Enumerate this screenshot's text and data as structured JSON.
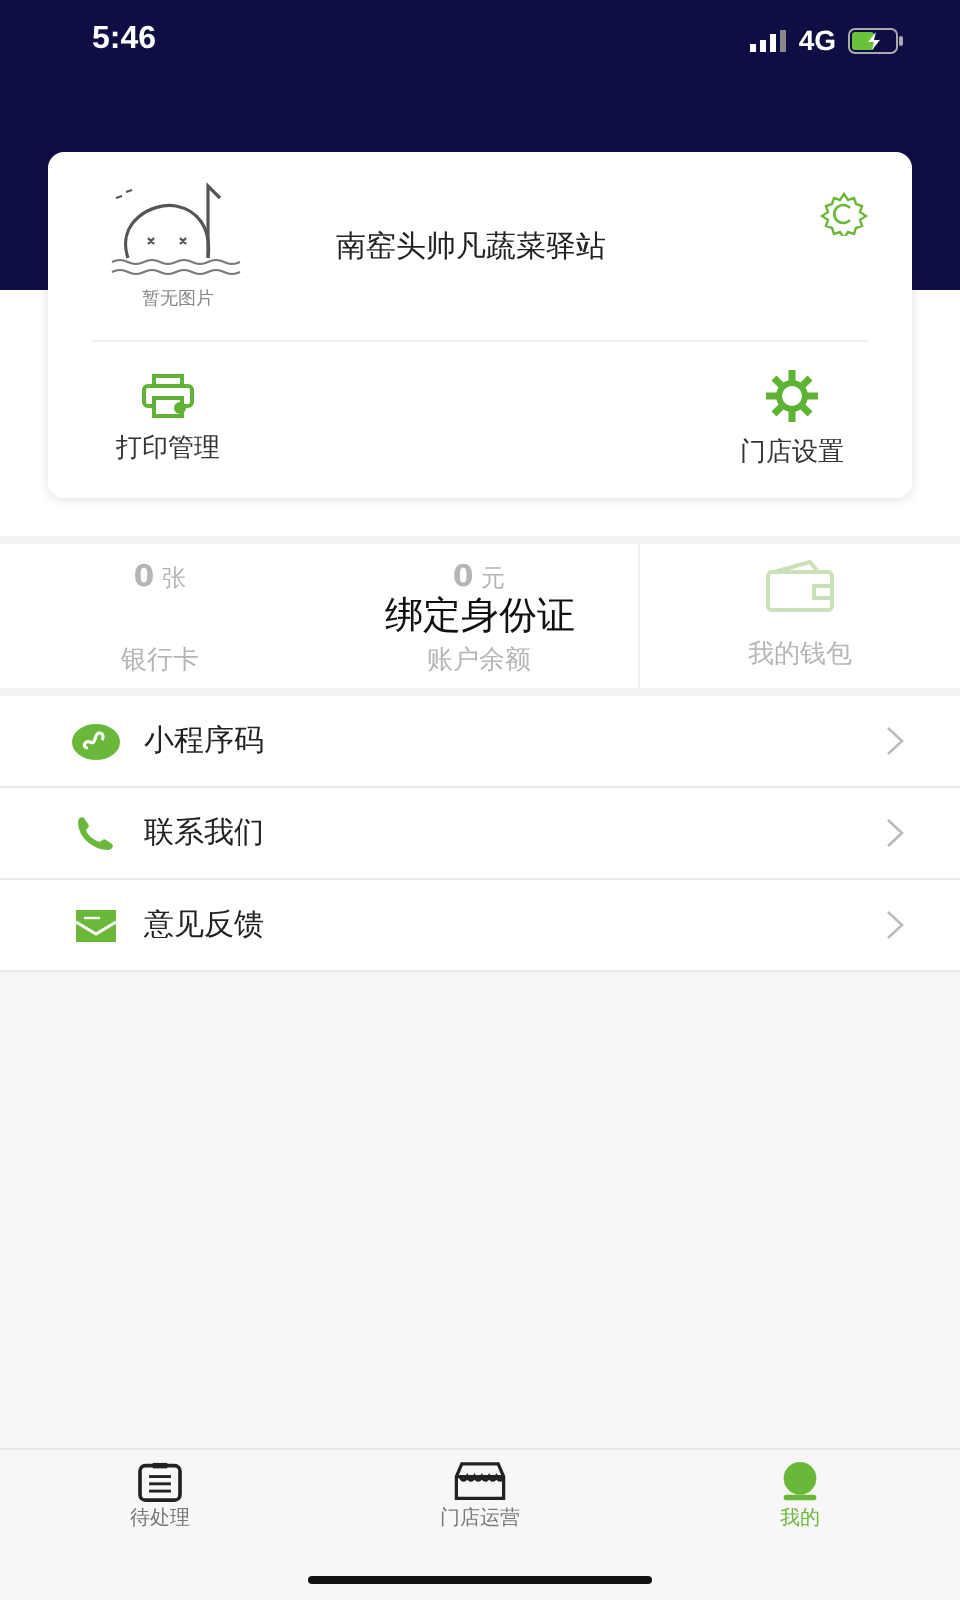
{
  "status_bar": {
    "time": "5:46",
    "network": "4G"
  },
  "store_card": {
    "placeholder_caption": "暂无图片",
    "store_name": "南窑头帅凡蔬菜驿站",
    "actions": [
      {
        "label": "打印管理",
        "kind": "printer"
      },
      {
        "label": "门店设置",
        "kind": "gear"
      }
    ]
  },
  "stats": [
    {
      "value": "0",
      "unit": "张",
      "label": "银行卡",
      "kind": "count"
    },
    {
      "value": "0",
      "unit": "元",
      "label": "账户余额",
      "kind": "count"
    },
    {
      "label": "我的钱包",
      "kind": "wallet"
    }
  ],
  "overlay_title": "绑定身份证",
  "menu": [
    {
      "label": "小程序码",
      "kind": "miniapp"
    },
    {
      "label": "联系我们",
      "kind": "phone"
    },
    {
      "label": "意见反馈",
      "kind": "mail"
    }
  ],
  "tab_bar": [
    {
      "label": "待处理",
      "kind": "clipboard",
      "selected": false
    },
    {
      "label": "门店运营",
      "kind": "store",
      "selected": false
    },
    {
      "label": "我的",
      "kind": "person",
      "selected": true
    }
  ]
}
